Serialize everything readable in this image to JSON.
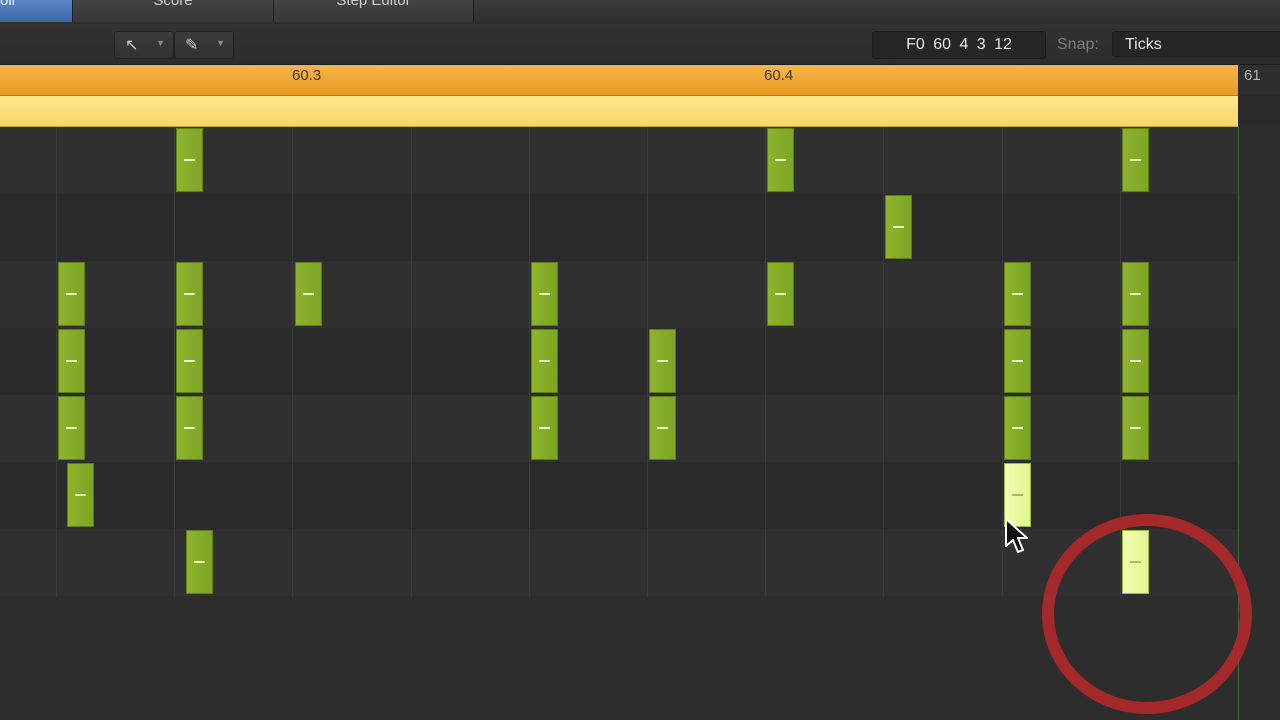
{
  "tabs": [
    {
      "label": "oll",
      "active": true
    },
    {
      "label": "Score",
      "active": false
    },
    {
      "label": "Step Editor",
      "active": false
    }
  ],
  "toolbar": {
    "pointer_tool": "pointer-icon",
    "pencil_tool": "pencil-icon",
    "position_display": "F0   60 4 3 12",
    "snap_label": "Snap:",
    "snap_value": "Ticks"
  },
  "ruler": {
    "labels": [
      "60.3",
      "60.4"
    ],
    "end_label": "61"
  },
  "colors": {
    "ruler": "#f0a83a",
    "region": "#fde07a",
    "note": "#86ad28",
    "note_selected": "#eafca6",
    "highlight_ring": "#b0282a"
  }
}
